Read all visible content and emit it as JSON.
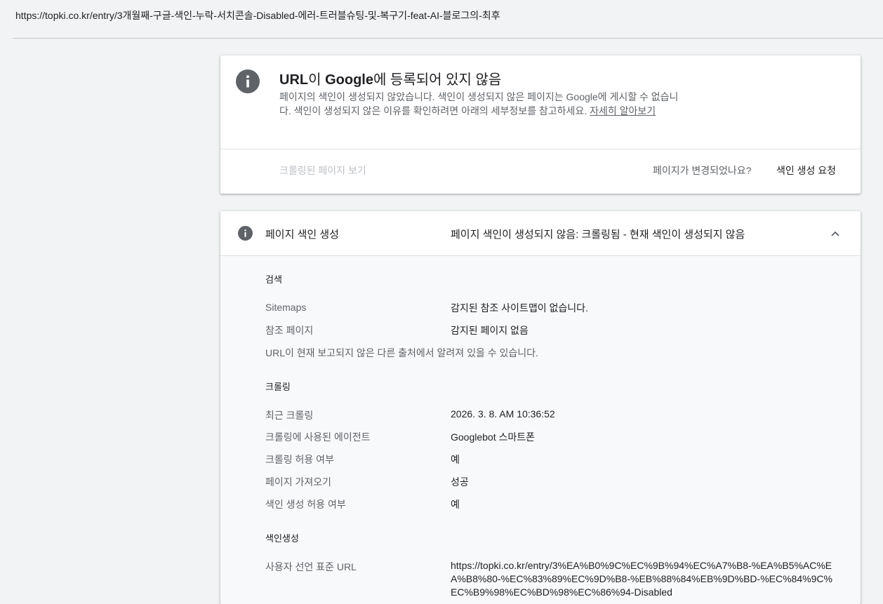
{
  "address_bar": {
    "url": "https://topki.co.kr/entry/3개월째-구글-색인-누락-서치콘솔-Disabled-에러-트러블슈팅-및-복구기-feat-AI-블로그의-최후"
  },
  "status_card": {
    "title_prefix": "URL",
    "title_mid": "이 ",
    "title_brand": "Google",
    "title_suffix": "에 등록되어 있지 않음",
    "description": "페이지의 색인이 생성되지 않았습니다. 색인이 생성되지 않은 페이지는 Google에 게시할 수 없습니다. 색인이 생성되지 않은 이유를 확인하려면 아래의 세부정보를 참고하세요.",
    "learn_more": "자세히 알아보기",
    "view_crawled": "크롤링된 페이지 보기",
    "page_changed": "페이지가 변경되었나요?",
    "request_indexing": "색인 생성 요청",
    "icon": "info-icon",
    "icon_color": "#5f6368"
  },
  "indexing_section": {
    "title": "페이지 색인 생성",
    "status": "페이지 색인이 생성되지 않음: 크롤링됨 - 현재 색인이 생성되지 않음",
    "discovery": {
      "title": "검색",
      "sitemaps_label": "Sitemaps",
      "sitemaps_value": "감지된 참조 사이트맵이 없습니다.",
      "referring_label": "참조 페이지",
      "referring_value": "감지된 페이지 없음",
      "note": "URL이 현재 보고되지 않은 다른 출처에서 알려져 있을 수 있습니다."
    },
    "crawl": {
      "title": "크롤링",
      "last_crawl_label": "최근 크롤링",
      "last_crawl_value": "2026. 3. 8. AM 10:36:52",
      "agent_label": "크롤링에 사용된 에이전트",
      "agent_value": "Googlebot 스마트폰",
      "allowed_label": "크롤링 허용 여부",
      "allowed_value": "예",
      "fetch_label": "페이지 가져오기",
      "fetch_value": "성공",
      "indexing_allowed_label": "색인 생성 허용 여부",
      "indexing_allowed_value": "예"
    },
    "indexing": {
      "title": "색인생성",
      "canonical_label": "사용자 선언 표준 URL",
      "canonical_value": "https://topki.co.kr/entry/3%EA%B0%9C%EC%9B%94%EC%A7%B8-%EA%B5%AC%EA%B8%80-%EC%83%89%EC%9D%B8-%EB%88%84%EB%9D%BD-%EC%84%9C%EC%B9%98%EC%BD%98%EC%86%94-Disabled"
    }
  }
}
